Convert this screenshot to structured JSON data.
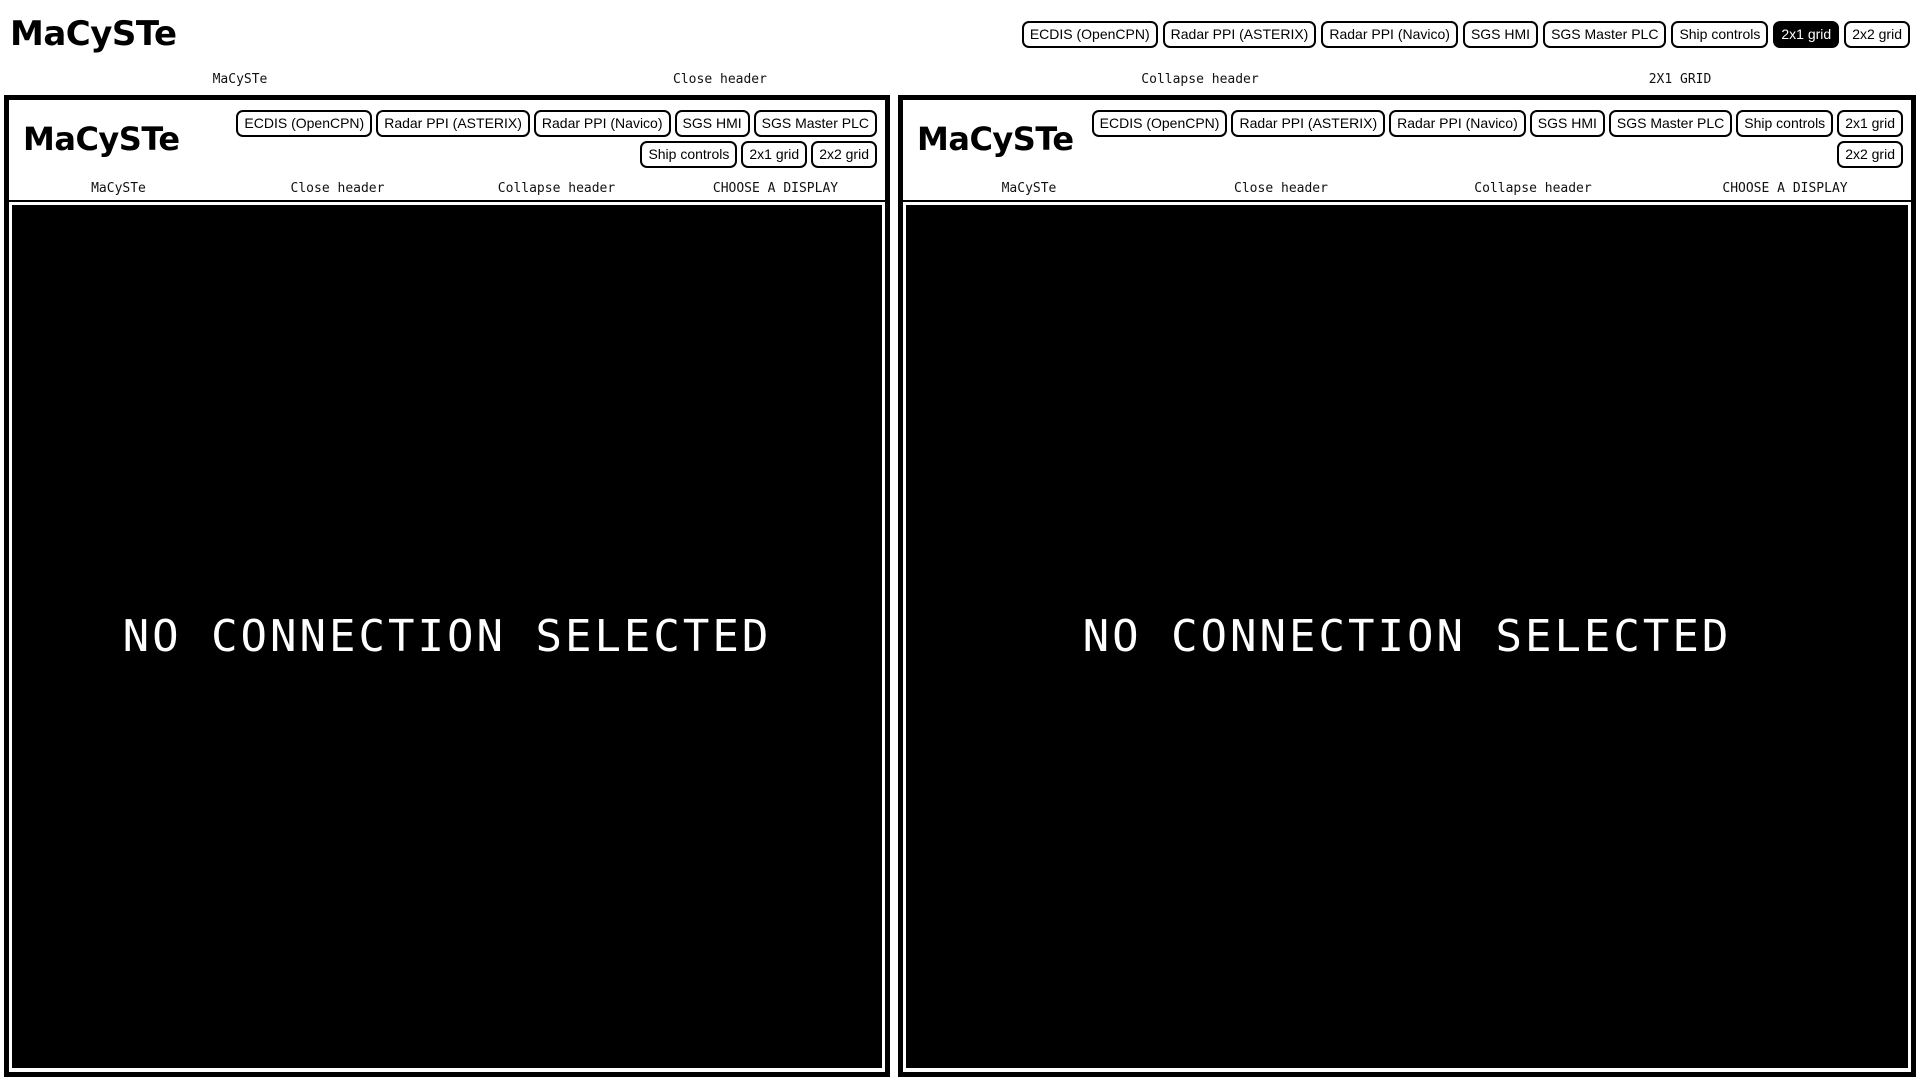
{
  "app": {
    "title": "MaCySTe"
  },
  "top_header": {
    "brand": "MaCySTe",
    "buttons": [
      {
        "label": "ECDIS (OpenCPN)",
        "selected": false
      },
      {
        "label": "Radar PPI (ASTERIX)",
        "selected": false
      },
      {
        "label": "Radar PPI (Navico)",
        "selected": false
      },
      {
        "label": "SGS HMI",
        "selected": false
      },
      {
        "label": "SGS Master PLC",
        "selected": false
      },
      {
        "label": "Ship controls",
        "selected": false
      },
      {
        "label": "2x1 grid",
        "selected": true
      },
      {
        "label": "2x2 grid",
        "selected": false
      }
    ],
    "labels": [
      "MaCySTe",
      "Close header",
      "Collapse header",
      "2X1 GRID"
    ]
  },
  "panels": [
    {
      "title": "MaCySTe",
      "buttons": [
        {
          "label": "ECDIS (OpenCPN)",
          "selected": false
        },
        {
          "label": "Radar PPI (ASTERIX)",
          "selected": false
        },
        {
          "label": "Radar PPI (Navico)",
          "selected": false
        },
        {
          "label": "SGS HMI",
          "selected": false
        },
        {
          "label": "SGS Master PLC",
          "selected": false
        },
        {
          "label": "Ship controls",
          "selected": false
        },
        {
          "label": "2x1 grid",
          "selected": false
        },
        {
          "label": "2x2 grid",
          "selected": false
        }
      ],
      "labels": [
        "MaCySTe",
        "Close header",
        "Collapse header",
        "CHOOSE A DISPLAY"
      ],
      "body_text": "NO CONNECTION SELECTED"
    },
    {
      "title": "MaCySTe",
      "buttons": [
        {
          "label": "ECDIS (OpenCPN)",
          "selected": false
        },
        {
          "label": "Radar PPI (ASTERIX)",
          "selected": false
        },
        {
          "label": "Radar PPI (Navico)",
          "selected": false
        },
        {
          "label": "SGS HMI",
          "selected": false
        },
        {
          "label": "SGS Master PLC",
          "selected": false
        },
        {
          "label": "Ship controls",
          "selected": false
        },
        {
          "label": "2x1 grid",
          "selected": false
        },
        {
          "label": "2x2 grid",
          "selected": false
        }
      ],
      "labels": [
        "MaCySTe",
        "Close header",
        "Collapse header",
        "CHOOSE A DISPLAY"
      ],
      "body_text": "NO CONNECTION SELECTED"
    }
  ],
  "colors": {
    "background": "#ffffff",
    "foreground": "#000000",
    "panel_body": "#000000",
    "panel_body_text": "#ffffff",
    "selected_bg": "#000000",
    "selected_fg": "#ffffff"
  }
}
